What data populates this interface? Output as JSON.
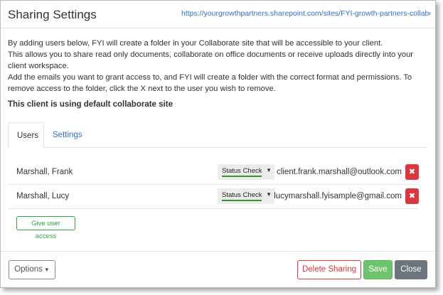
{
  "dialog": {
    "title": "Sharing Settings",
    "url": "https://yourgrowthpartners.sharepoint.com/sites/FYI-growth-partners-collaborate-..."
  },
  "intro": {
    "line1": "By adding users below, FYI will create a folder in your Collaborate site that will be accessible to your client.",
    "line2": "This allows you to share read only documents, collaborate on office documents or receive uploads directly into your client workspace.",
    "line3": "Add the emails you want to grant access to, and FYI will create a folder with the correct format and permissions. To remove access to the folder, click the X next to the user you wish to remove."
  },
  "default_note": "This client is using default collaborate site",
  "tabs": [
    {
      "label": "Users",
      "active": true
    },
    {
      "label": "Settings",
      "active": false
    }
  ],
  "users": [
    {
      "name": "Marshall, Frank",
      "status": "Status Check",
      "email": "client.frank.marshall@outlook.com",
      "remove_icon": "close-icon"
    },
    {
      "name": "Marshall, Lucy",
      "status": "Status Check",
      "email": "lucymarshall.fyisample@gmail.com",
      "remove_icon": "close-icon"
    }
  ],
  "give_access_label": "Give user access",
  "footer": {
    "options_label": "Options",
    "delete_label": "Delete Sharing",
    "save_label": "Save",
    "close_label": "Close"
  },
  "colors": {
    "link": "#2f6fcf",
    "danger": "#d9363e",
    "success": "#28a745",
    "save": "#6cc56c",
    "close": "#6c757d",
    "status_bar": "#2e9a2e"
  }
}
